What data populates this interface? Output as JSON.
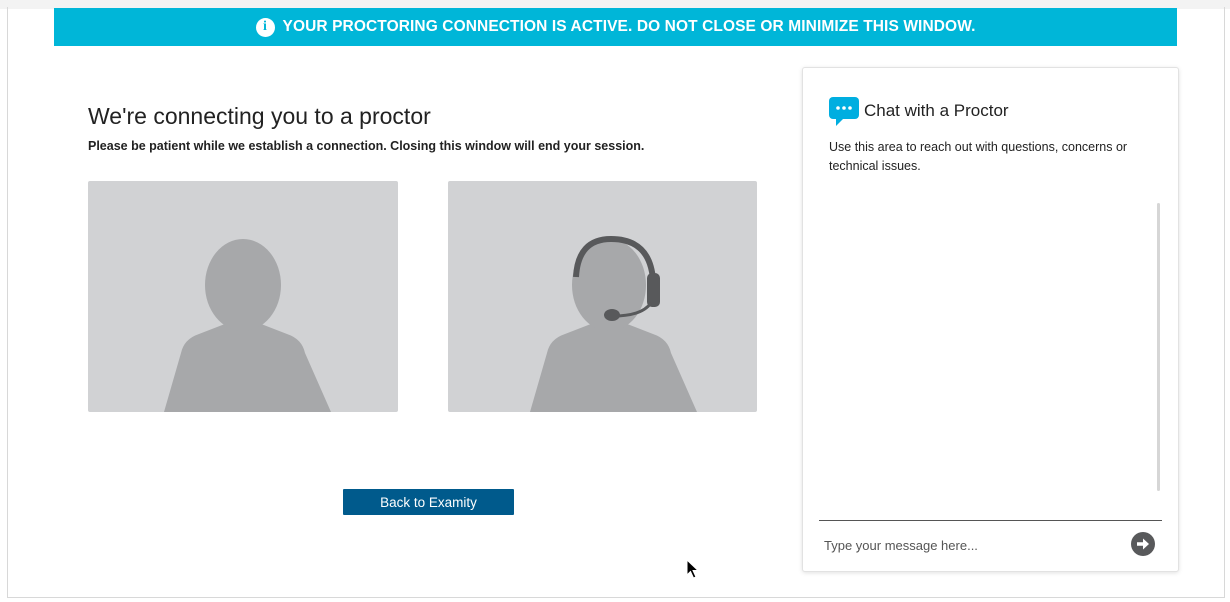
{
  "banner": {
    "text": "YOUR PROCTORING CONNECTION IS ACTIVE. DO NOT CLOSE OR MINIMIZE THIS WINDOW.",
    "icon": "info-icon",
    "color": "#00b6d8"
  },
  "main": {
    "title": "We're connecting you to a proctor",
    "subtitle": "Please be patient while we establish a connection. Closing this window will end your session.",
    "tiles": [
      {
        "icon": "user-silhouette-icon"
      },
      {
        "icon": "proctor-headset-silhouette-icon"
      }
    ],
    "back_button_label": "Back to Examity",
    "button_color": "#005a8c"
  },
  "chat": {
    "title": "Chat with a Proctor",
    "icon": "chat-bubble-icon",
    "description": "Use this area to reach out with questions, concerns or technical issues.",
    "input_placeholder": "Type your message here...",
    "send_icon": "arrow-right-circle-icon"
  }
}
